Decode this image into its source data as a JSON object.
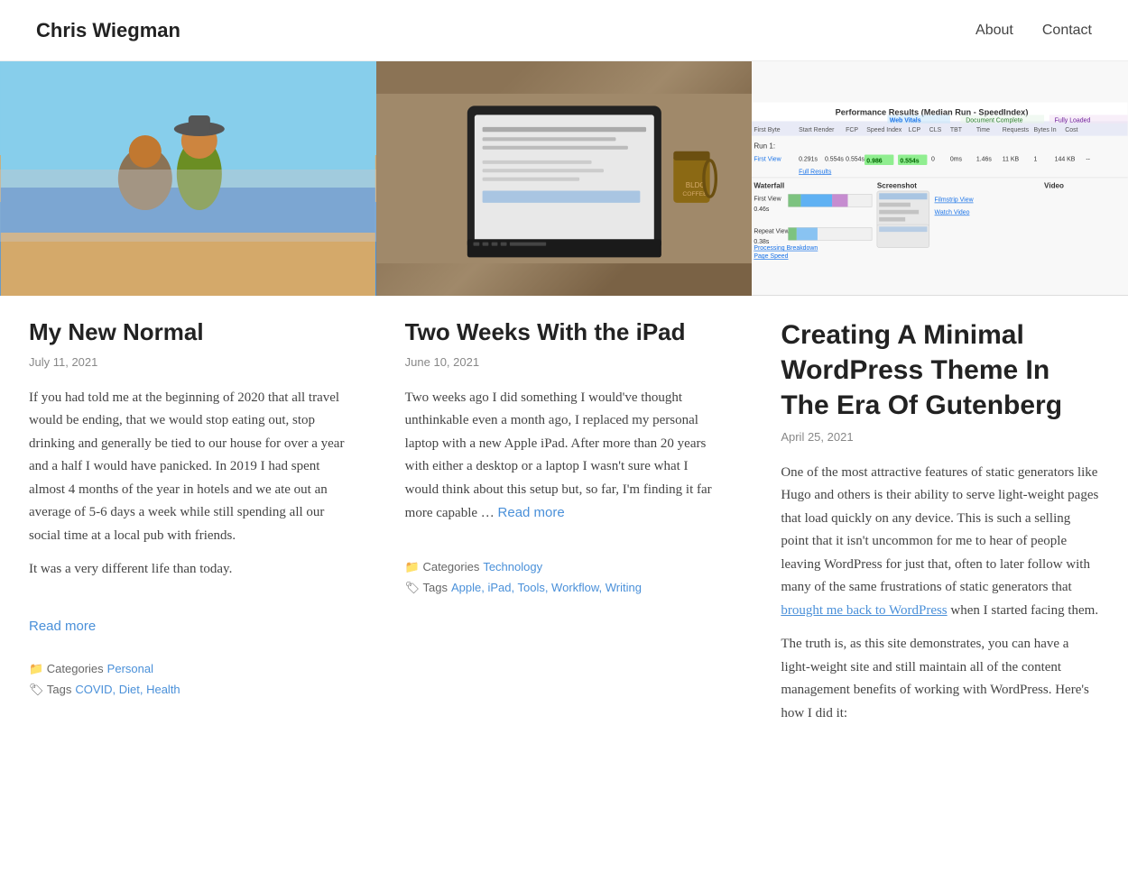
{
  "site": {
    "title": "Chris Wiegman",
    "nav": [
      {
        "label": "About",
        "href": "#about"
      },
      {
        "label": "Contact",
        "href": "#contact"
      }
    ]
  },
  "articles": [
    {
      "id": "my-new-normal",
      "title": "My New Normal",
      "date": "July 11, 2021",
      "excerpt_1": "If you had told me at the beginning of 2020 that all travel would be ending, that we would stop eating out, stop drinking and generally be tied to our house for over a year and a half I would have panicked. In 2019 I had spent almost 4 months of the year in hotels and we ate out an average of 5-6 days a week while still spending all our social time at a local pub with friends.",
      "excerpt_2": "It was a very different life than today.",
      "read_more": "Read more",
      "categories_label": "Categories",
      "categories_value": "Personal",
      "tags_label": "Tags",
      "tags_value": "COVID, Diet, Health",
      "image_type": "beach"
    },
    {
      "id": "two-weeks-ipad",
      "title": "Two Weeks With the iPad",
      "date": "June 10, 2021",
      "excerpt": "Two weeks ago I did something I would've thought unthinkable even a month ago, I replaced my personal laptop with a new Apple iPad. After more than 20 years with either a desktop or a laptop I wasn't sure what I would think about this setup but, so far, I'm finding it far more capable …",
      "read_more": "Read more",
      "categories_label": "Categories",
      "categories_value": "Technology",
      "tags_label": "Tags",
      "tags_value": "Apple, iPad, Tools, Workflow, Writing",
      "image_type": "ipad"
    },
    {
      "id": "minimal-wordpress-theme",
      "title": "Creating A Minimal WordPress Theme In The Era Of Gutenberg",
      "date": "April 25, 2021",
      "excerpt_1": "One of the most attractive features of static generators like Hugo and others is their ability to serve light-weight pages that load quickly on any device. This is such a selling point that it isn't uncommon for me to hear of people leaving WordPress for just that, often to later follow with many of the same frustrations of static generators that",
      "inline_link_text": "brought me back to WordPress",
      "excerpt_2": "when I started facing them.",
      "excerpt_3": "The truth is, as this site demonstrates, you can have a light-weight site and still maintain all of the content management benefits of working with WordPress.",
      "heres_how": "Here's how",
      "excerpt_4": "I did it:",
      "image_type": "perf"
    }
  ],
  "perf_chart": {
    "title": "Performance Results (Median Run - SpeedIndex)",
    "subtitle_left": "Web Vitals",
    "subtitle_right": "Document Complete",
    "subtitle_far_right": "Fully Loaded"
  }
}
